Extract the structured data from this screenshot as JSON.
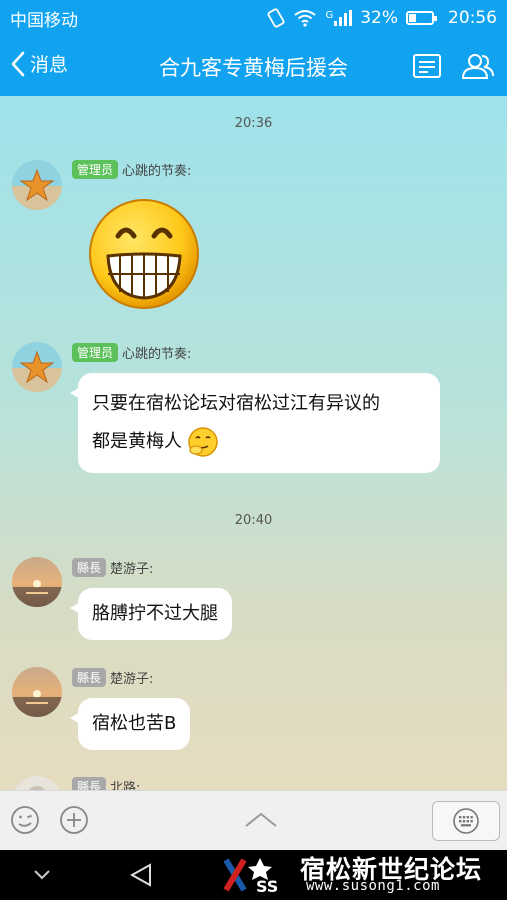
{
  "status_bar": {
    "carrier": "中国移动",
    "network": "G",
    "battery": "32%",
    "time": "20:56"
  },
  "nav": {
    "back_label": "消息",
    "title": "合九客专黄梅后援会"
  },
  "messages": [
    {
      "type": "time",
      "text": "20:36"
    },
    {
      "type": "message",
      "badge": "管理员",
      "sender": "心跳的节奏:",
      "content_kind": "sticker",
      "sticker": "grinning-face-sticker"
    },
    {
      "type": "message",
      "badge": "管理员",
      "sender": "心跳的节奏:",
      "lines": [
        "只要在宿松论坛对宿松过江有异议的",
        "都是黄梅人"
      ],
      "emoji": "thinking-smiley"
    },
    {
      "type": "time",
      "text": "20:40"
    },
    {
      "type": "message",
      "badge": "縣長",
      "sender": "楚游子:",
      "lines": [
        "胳膊拧不过大腿"
      ]
    },
    {
      "type": "message",
      "badge": "縣長",
      "sender": "楚游子:",
      "lines": [
        "宿松也苦B"
      ]
    },
    {
      "type": "message",
      "badge": "縣長",
      "sender": "北路:"
    }
  ],
  "watermark": {
    "logo_text": "SS",
    "title": "宿松新世纪论坛",
    "url": "www.susong1.com"
  }
}
